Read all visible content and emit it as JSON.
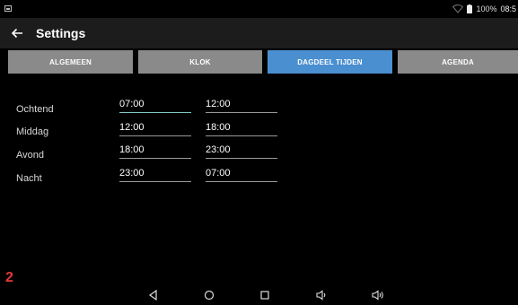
{
  "status_bar": {
    "battery": "100%",
    "time": "08:5"
  },
  "app_bar": {
    "title": "Settings"
  },
  "tabs": [
    {
      "label": "ALGEMEEN",
      "active": false
    },
    {
      "label": "KLOK",
      "active": false
    },
    {
      "label": "DAGDEEL TIJDEN",
      "active": true
    },
    {
      "label": "AGENDA",
      "active": false
    }
  ],
  "dayparts": [
    {
      "label": "Ochtend",
      "start": "07:00",
      "end": "12:00"
    },
    {
      "label": "Middag",
      "start": "12:00",
      "end": "18:00"
    },
    {
      "label": "Avond",
      "start": "18:00",
      "end": "23:00"
    },
    {
      "label": "Nacht",
      "start": "23:00",
      "end": "07:00"
    }
  ],
  "overlay": {
    "page_number": "2"
  },
  "colors": {
    "active_tab": "#4a8fd0",
    "inactive_tab": "#8a8a8a",
    "focused_underline": "#80cbc4",
    "page_number": "#e53935"
  }
}
